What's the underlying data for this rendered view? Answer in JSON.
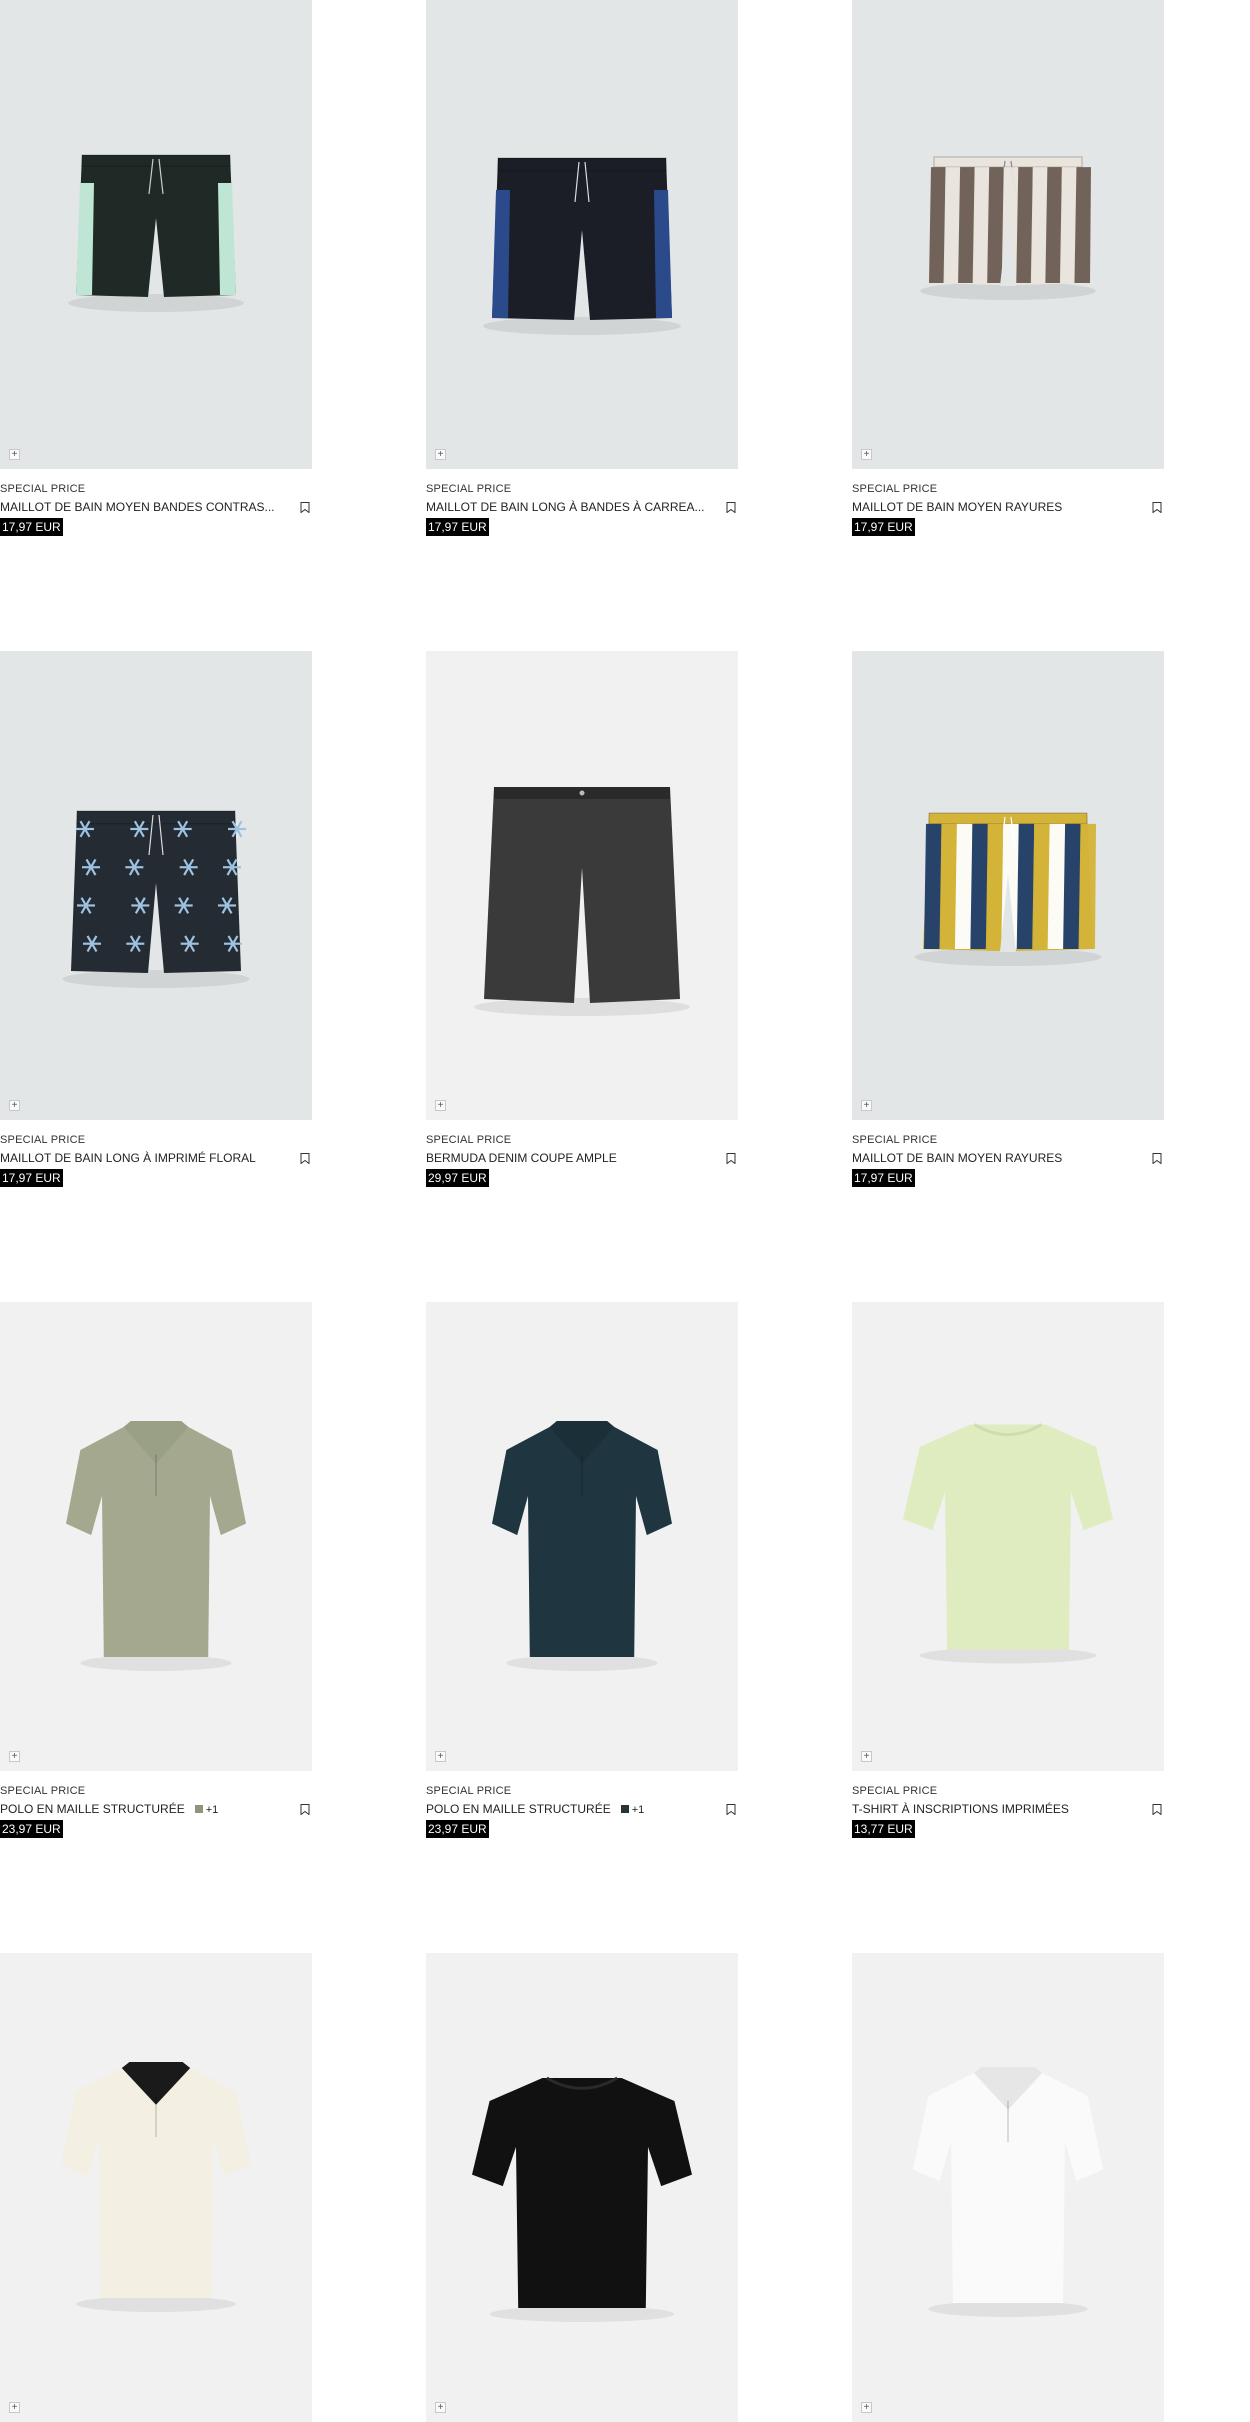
{
  "products": [
    {
      "badge": "SPECIAL PRICE",
      "name": "MAILLOT DE BAIN MOYEN BANDES CONTRAS...",
      "price": "17,97 EUR",
      "bg": "#e3e6e7",
      "item": "swim-contrast-stripes"
    },
    {
      "badge": "SPECIAL PRICE",
      "name": "MAILLOT DE BAIN LONG À BANDES À CARREA...",
      "price": "17,97 EUR",
      "bg": "#e3e6e7",
      "item": "swim-check-bands"
    },
    {
      "badge": "SPECIAL PRICE",
      "name": "MAILLOT DE BAIN MOYEN RAYURES",
      "price": "17,97 EUR",
      "bg": "#e3e6e7",
      "item": "swim-brown-stripes"
    },
    {
      "badge": "SPECIAL PRICE",
      "name": "MAILLOT DE BAIN LONG À IMPRIMÉ FLORAL",
      "price": "17,97 EUR",
      "bg": "#e3e6e7",
      "item": "swim-floral"
    },
    {
      "badge": "SPECIAL PRICE",
      "name": "BERMUDA DENIM COUPE AMPLE",
      "price": "29,97 EUR",
      "bg": "#f1f1f1",
      "item": "denim-bermuda"
    },
    {
      "badge": "SPECIAL PRICE",
      "name": "MAILLOT DE BAIN MOYEN RAYURES",
      "price": "17,97 EUR",
      "bg": "#e3e6e7",
      "item": "swim-yellow-stripes"
    },
    {
      "badge": "SPECIAL PRICE",
      "name": "POLO EN MAILLE STRUCTURÉE",
      "price": "23,97 EUR",
      "bg": "#f1f1f1",
      "item": "polo-sage",
      "swatch": "#8f957b",
      "more": "+1"
    },
    {
      "badge": "SPECIAL PRICE",
      "name": "POLO EN MAILLE STRUCTURÉE",
      "price": "23,97 EUR",
      "bg": "#f1f1f1",
      "item": "polo-navy",
      "swatch": "#26343a",
      "more": "+1"
    },
    {
      "badge": "SPECIAL PRICE",
      "name": "T-SHIRT À INSCRIPTIONS IMPRIMÉES",
      "price": "13,77 EUR",
      "bg": "#f1f1f1",
      "item": "tee-lime"
    },
    {
      "bg": "#f1f1f1",
      "item": "shirt-cream-trim"
    },
    {
      "bg": "#f1f1f1",
      "item": "tee-black"
    },
    {
      "bg": "#f1f1f1",
      "item": "polo-white"
    }
  ],
  "icons": {
    "quick_add": "plus-icon",
    "save": "bookmark-icon"
  }
}
